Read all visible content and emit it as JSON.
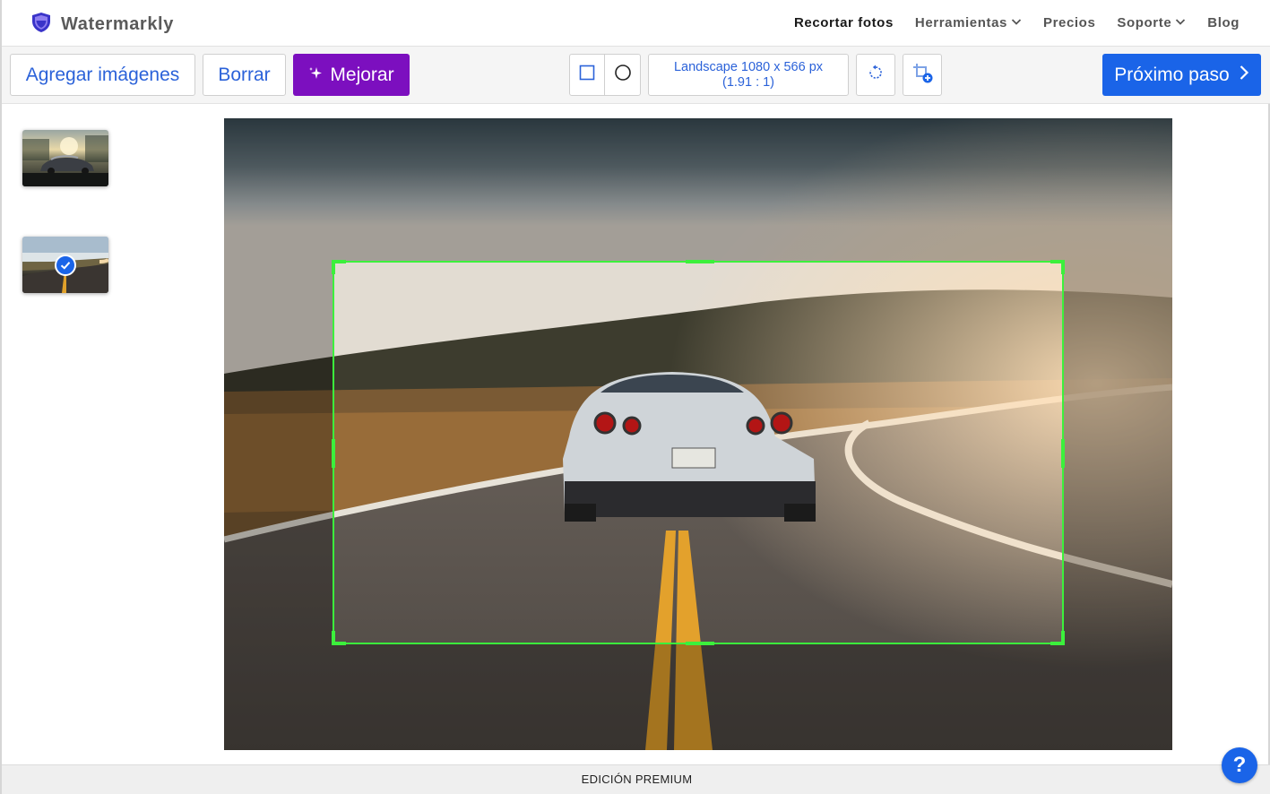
{
  "app": {
    "name": "Watermarkly"
  },
  "nav": {
    "items": [
      {
        "label": "Recortar fotos",
        "active": true,
        "dropdown": false
      },
      {
        "label": "Herramientas",
        "active": false,
        "dropdown": true
      },
      {
        "label": "Precios",
        "active": false,
        "dropdown": false
      },
      {
        "label": "Soporte",
        "active": false,
        "dropdown": true
      },
      {
        "label": "Blog",
        "active": false,
        "dropdown": false
      }
    ]
  },
  "toolbar": {
    "add_images": "Agregar imágenes",
    "delete": "Borrar",
    "enhance": "Mejorar",
    "aspect_line1": "Landscape 1080 x 566 px",
    "aspect_line2": "(1.91 : 1)",
    "next_step": "Próximo paso"
  },
  "sidebar": {
    "thumbnails": [
      {
        "icon": "car-photo",
        "selected": false
      },
      {
        "icon": "road-photo",
        "selected": true
      }
    ]
  },
  "footer": {
    "label": "EDICIÓN PREMIUM"
  },
  "help": {
    "label": "?"
  },
  "colors": {
    "accent_blue": "#1a64e8",
    "enhance_purple": "#7c0fbf",
    "crop_green": "#3cf03c"
  }
}
